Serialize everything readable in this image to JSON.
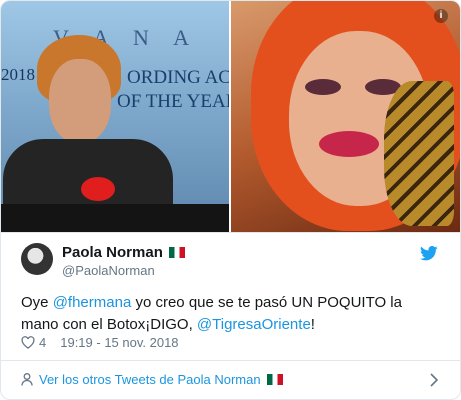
{
  "media": {
    "left_photo": {
      "brand_text": "V A N A",
      "year_text": "2018",
      "line1": "ORDING ACA",
      "line2": "OF THE YEAR"
    }
  },
  "author": {
    "name": "Paola Norman",
    "handle": "@PaolaNorman"
  },
  "tweet": {
    "text_part1": "Oye ",
    "mention1": "@fhermana",
    "text_part2": " yo creo que se te pasó UN POQUITO la mano con el Botox¡DIGO, ",
    "mention2": "@TigresaOriente",
    "text_part3": "!"
  },
  "meta": {
    "likes": "4",
    "timestamp": "19:19 - 15 nov. 2018"
  },
  "footer": {
    "link_text": "Ver los otros Tweets de Paola Norman"
  },
  "icons": {
    "twitter": "twitter-bird-icon",
    "like": "heart-icon",
    "info": "info-icon",
    "user": "user-icon",
    "chevron": "chevron-right-icon"
  },
  "colors": {
    "link": "#1b95e0",
    "muted": "#657786",
    "text": "#14171a",
    "twitter_blue": "#1da1f2"
  }
}
